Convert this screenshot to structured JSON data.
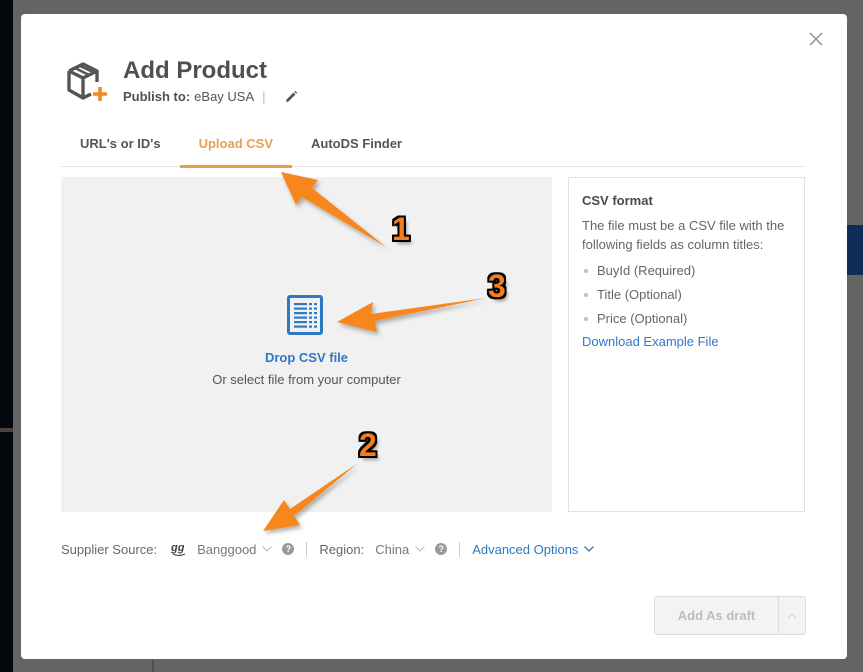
{
  "backdrop": {
    "text": "— ——— ——— — ————— ———"
  },
  "modal": {
    "title": "Add Product",
    "publish_label": "Publish to:",
    "publish_value": "eBay USA",
    "publish_separator": "|",
    "close_label": "X"
  },
  "tabs": [
    {
      "label": "URL's or ID's",
      "active": false
    },
    {
      "label": "Upload CSV",
      "active": true
    },
    {
      "label": "AutoDS Finder",
      "active": false
    }
  ],
  "dropzone": {
    "title": "Drop CSV file",
    "subtitle": "Or select file from your computer"
  },
  "csv_format": {
    "title": "CSV format",
    "description": "The file must be a CSV file with the following fields as column titles:",
    "fields": [
      "BuyId (Required)",
      "Title (Optional)",
      "Price (Optional)"
    ],
    "download_link": "Download Example File"
  },
  "options": {
    "supplier_label": "Supplier Source:",
    "supplier_value": "Banggood",
    "region_label": "Region:",
    "region_value": "China",
    "help_glyph": "?",
    "advanced_label": "Advanced Options"
  },
  "actions": {
    "add_draft_label": "Add As draft"
  },
  "annotations": [
    {
      "number": "1",
      "target": "tab-upload-csv"
    },
    {
      "number": "2",
      "target": "supplier-source-select"
    },
    {
      "number": "3",
      "target": "csv-file-icon"
    }
  ],
  "colors": {
    "accent_orange": "#e8a04d",
    "link_blue": "#2f78c4",
    "annotation_orange": "#f47d1f"
  }
}
